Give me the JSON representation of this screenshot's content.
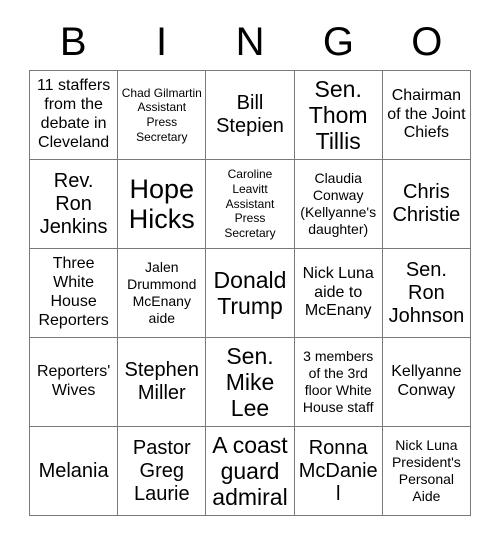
{
  "card": {
    "title": "BINGO",
    "header_letters": [
      "B",
      "I",
      "N",
      "G",
      "O"
    ],
    "rows": 5,
    "columns": 5,
    "colors": {
      "background": "#ffffff",
      "text": "#000000",
      "grid_line": "#7a7a7a"
    },
    "cells": [
      [
        {
          "text": "11 staffers from the debate in Cleveland",
          "size": "md"
        },
        {
          "text": "Chad Gilmartin Assistant Press Secretary",
          "size": "xs"
        },
        {
          "text": "Bill Stepien",
          "size": "lg"
        },
        {
          "text": "Sen. Thom Tillis",
          "size": "xl"
        },
        {
          "text": "Chairman of the Joint Chiefs",
          "size": "md"
        }
      ],
      [
        {
          "text": "Rev. Ron Jenkins",
          "size": "lg"
        },
        {
          "text": "Hope Hicks",
          "size": "xxl"
        },
        {
          "text": "Caroline Leavitt Assistant Press Secretary",
          "size": "xs"
        },
        {
          "text": "Claudia Conway (Kellyanne's daughter)",
          "size": "sm"
        },
        {
          "text": "Chris Christie",
          "size": "lg"
        }
      ],
      [
        {
          "text": "Three White House Reporters",
          "size": "md"
        },
        {
          "text": "Jalen Drummond McEnany aide",
          "size": "sm"
        },
        {
          "text": "Donald Trump",
          "size": "xl"
        },
        {
          "text": "Nick Luna aide to McEnany",
          "size": "md"
        },
        {
          "text": "Sen. Ron Johnson",
          "size": "lg"
        }
      ],
      [
        {
          "text": "Reporters' Wives",
          "size": "md"
        },
        {
          "text": "Stephen Miller",
          "size": "lg"
        },
        {
          "text": "Sen. Mike Lee",
          "size": "xl"
        },
        {
          "text": "3 members of the 3rd floor White House staff",
          "size": "sm"
        },
        {
          "text": "Kellyanne Conway",
          "size": "md"
        }
      ],
      [
        {
          "text": "Melania",
          "size": "lg"
        },
        {
          "text": "Pastor Greg Laurie",
          "size": "lg"
        },
        {
          "text": "A coast guard admiral",
          "size": "xl"
        },
        {
          "text": "Ronna McDaniel",
          "size": "lg"
        },
        {
          "text": "Nick Luna President's Personal Aide",
          "size": "sm"
        }
      ]
    ]
  }
}
